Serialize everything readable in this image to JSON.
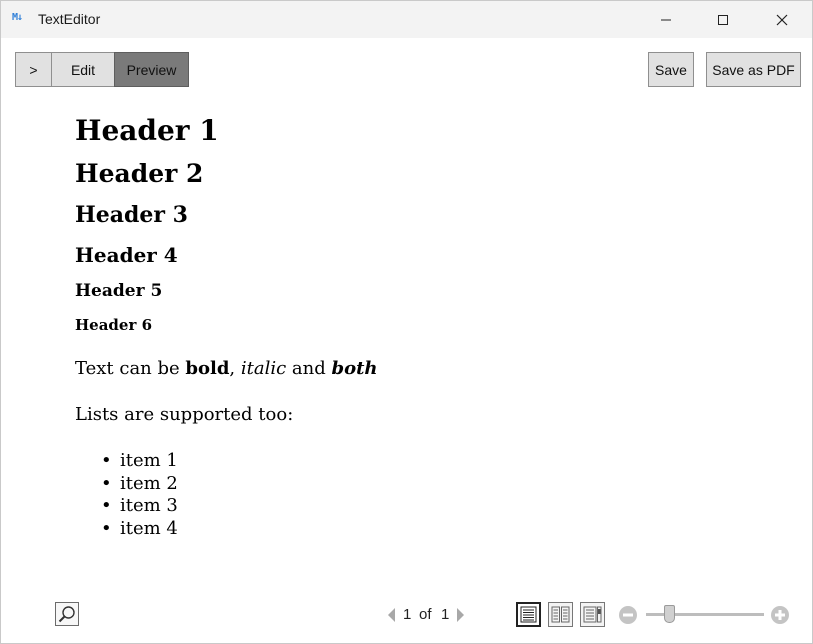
{
  "window": {
    "app_icon": "M↓",
    "title": "TextEditor"
  },
  "toolbar": {
    "toggle_label": ">",
    "edit_label": "Edit",
    "preview_label": "Preview",
    "save_label": "Save",
    "save_pdf_label": "Save as PDF",
    "active_mode": "Preview"
  },
  "document": {
    "h1": "Header 1",
    "h2": "Header 2",
    "h3": "Header 3",
    "h4": "Header 4",
    "h5": "Header 5",
    "h6": "Header 6",
    "para1": {
      "prefix": "Text can be ",
      "bold": "bold",
      "sep": ", ",
      "italic": "italic",
      "and": " and ",
      "bold_italic": "both"
    },
    "para2": "Lists are supported too:",
    "list_bullet": "•",
    "list_items": [
      "item 1",
      "item 2",
      "item 3",
      "item 4"
    ]
  },
  "footer": {
    "current_page": "1",
    "of_label": "of",
    "total_pages": "1",
    "zoom_level": 0.2
  },
  "icons": {
    "search": "search-icon",
    "prev": "chevron-left-icon",
    "next": "chevron-right-icon",
    "view_single": "single-page-view-icon",
    "view_double": "two-page-view-icon",
    "view_scroll": "scroll-view-icon",
    "zoom_out": "zoom-out-icon",
    "zoom_in": "zoom-in-icon",
    "minimize": "minimize-icon",
    "maximize": "maximize-icon",
    "close": "close-icon"
  }
}
